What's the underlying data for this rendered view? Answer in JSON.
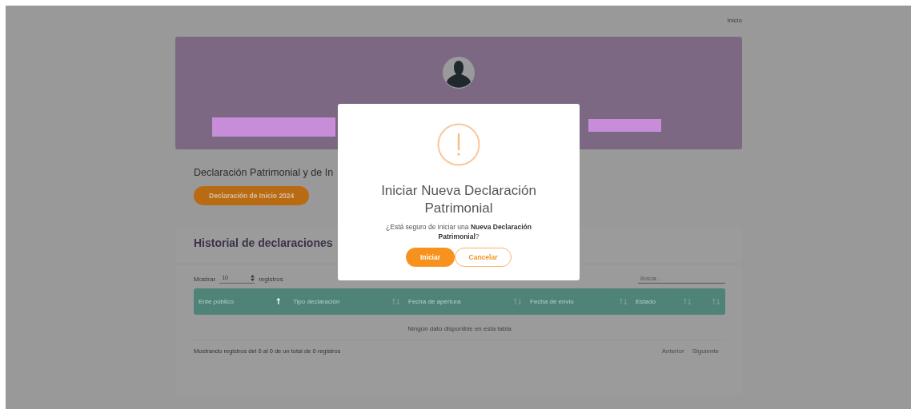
{
  "breadcrumb": "Inicio",
  "page_title": "Declaración Patrimonial y de In",
  "declaration_button": "Declaración de Inicio 2024",
  "history": {
    "title": "Historial de declaraciones",
    "length_label_before": "Mostrar",
    "length_value": "10",
    "length_label_after": "registros",
    "search": {
      "placeholder": "Buscar..."
    },
    "columns": [
      {
        "label": "Ente público",
        "sorted": true
      },
      {
        "label": "Tipo declaración",
        "sorted": false
      },
      {
        "label": "Fecha de apertura",
        "sorted": false
      },
      {
        "label": "Fecha de envio",
        "sorted": false
      },
      {
        "label": "Estado",
        "sorted": false
      },
      {
        "sorted": false
      }
    ],
    "empty_message": "Ningún dato disponible en esta tabla",
    "info": "Mostrando registros del 0 al 0 de un total de 0 registros",
    "pagination": [
      "Anterior",
      "Siguiente"
    ]
  },
  "modal": {
    "title": "Iniciar Nueva Declaración Patrimonial",
    "message": "¿Está seguro de iniciar una **Nueva Declaración Patrimonial**?",
    "confirm": "Iniciar",
    "cancel": "Cancelar"
  }
}
